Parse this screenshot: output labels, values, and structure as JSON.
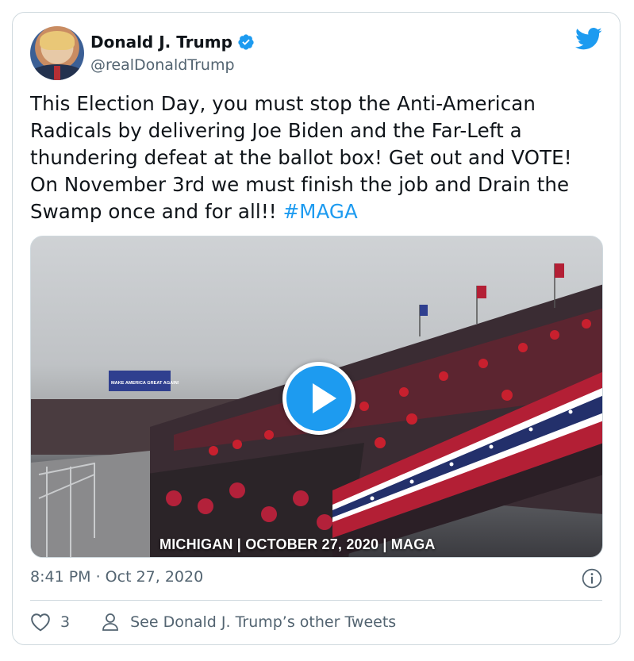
{
  "author": {
    "name": "Donald J. Trump",
    "handle": "@realDonaldTrump"
  },
  "tweet": {
    "text": "This Election Day, you must stop the Anti-American Radicals by delivering Joe Biden and the Far-Left a thundering defeat at the ballot box! Get out and VOTE! On November 3rd we must finish the job and Drain the Swamp once and for all!! ",
    "hashtag": "#MAGA"
  },
  "media": {
    "caption": "MICHIGAN | OCTOBER 27, 2020 | MAGA",
    "banner": "MAKE AMERICA GREAT AGAIN!"
  },
  "meta": {
    "timestamp": "8:41 PM · Oct 27, 2020"
  },
  "actions": {
    "like_count": "3",
    "profile_link": "See Donald J. Trump’s other Tweets"
  },
  "colors": {
    "accent": "#1d9bf0",
    "text": "#0f1419",
    "secondary": "#536471",
    "border": "#cfd9de"
  },
  "icons": [
    "verified-badge-icon",
    "twitter-bird-icon",
    "play-icon",
    "info-icon",
    "heart-icon",
    "person-icon"
  ]
}
